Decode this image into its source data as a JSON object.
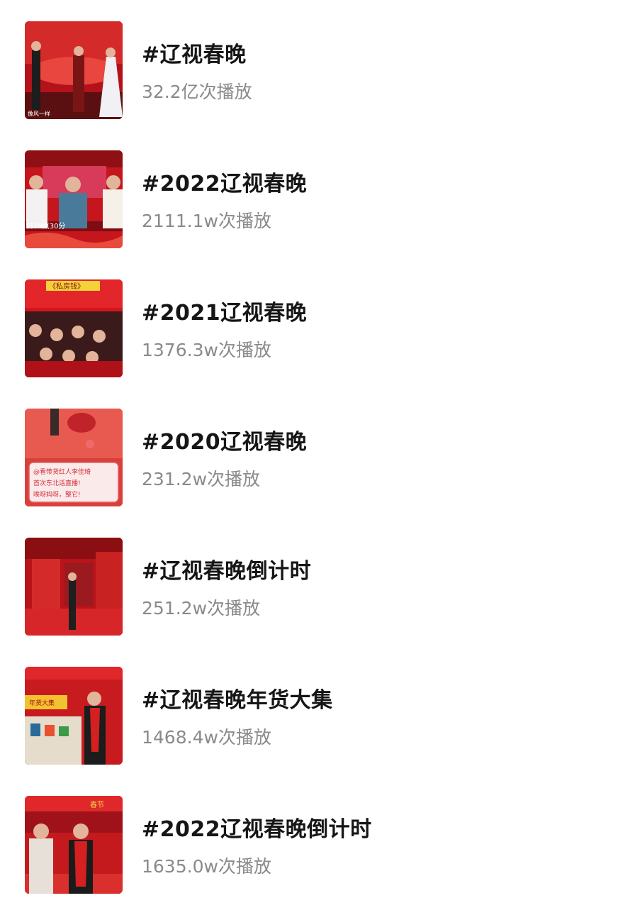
{
  "topics": [
    {
      "title": "#辽视春晚",
      "plays": "32.2亿次播放",
      "thumb_caption": "像风一样"
    },
    {
      "title": "#2022辽视春晚",
      "plays": "2111.1w次播放",
      "thumb_caption": "日19点30分"
    },
    {
      "title": "#2021辽视春晚",
      "plays": "1376.3w次播放",
      "thumb_caption": "《私房钱》"
    },
    {
      "title": "#2020辽视春晚",
      "plays": "231.2w次播放",
      "thumb_caption": "@看带货红人李佳琦\n首次东北话直播!\n唉呀妈呀，整它!"
    },
    {
      "title": "#辽视春晚倒计时",
      "plays": "251.2w次播放",
      "thumb_caption": ""
    },
    {
      "title": "#辽视春晚年货大集",
      "plays": "1468.4w次播放",
      "thumb_caption": "年货大集"
    },
    {
      "title": "#2022辽视春晚倒计时",
      "plays": "1635.0w次播放",
      "thumb_caption": "春节"
    }
  ],
  "colors": {
    "title": "#161616",
    "plays": "#8a8a8a",
    "thumb_red": "#c81a1a"
  }
}
